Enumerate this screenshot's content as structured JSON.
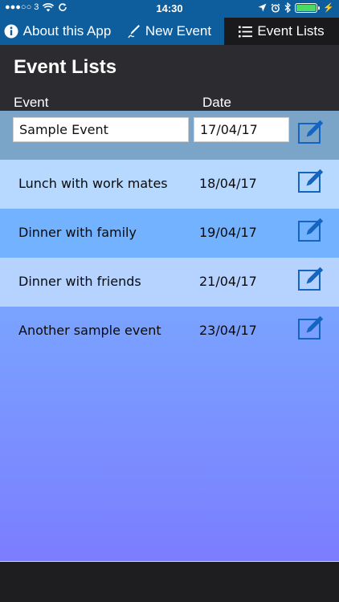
{
  "status_bar": {
    "carrier": "●●●○○ 3",
    "time": "14:30",
    "battery_charging_icon": "⚡"
  },
  "tabs": [
    {
      "label": "About this App",
      "icon": "info-icon"
    },
    {
      "label": "New Event",
      "icon": "pen-icon"
    },
    {
      "label": "Event Lists",
      "icon": "list-icon",
      "active": true
    }
  ],
  "header": {
    "title": "Event Lists",
    "col_event": "Event",
    "col_date": "Date"
  },
  "events": [
    {
      "name": "Sample Event",
      "date": "17/04/17",
      "editing": true
    },
    {
      "name": "Lunch with work mates",
      "date": "18/04/17"
    },
    {
      "name": "Dinner with family",
      "date": "19/04/17"
    },
    {
      "name": "Dinner with friends",
      "date": "21/04/17"
    },
    {
      "name": "Another sample event",
      "date": "23/04/17"
    }
  ],
  "colors": {
    "nav_blue": "#0e5d9c",
    "header_dark": "#2b2b30",
    "edit_icon": "#1565c0"
  }
}
